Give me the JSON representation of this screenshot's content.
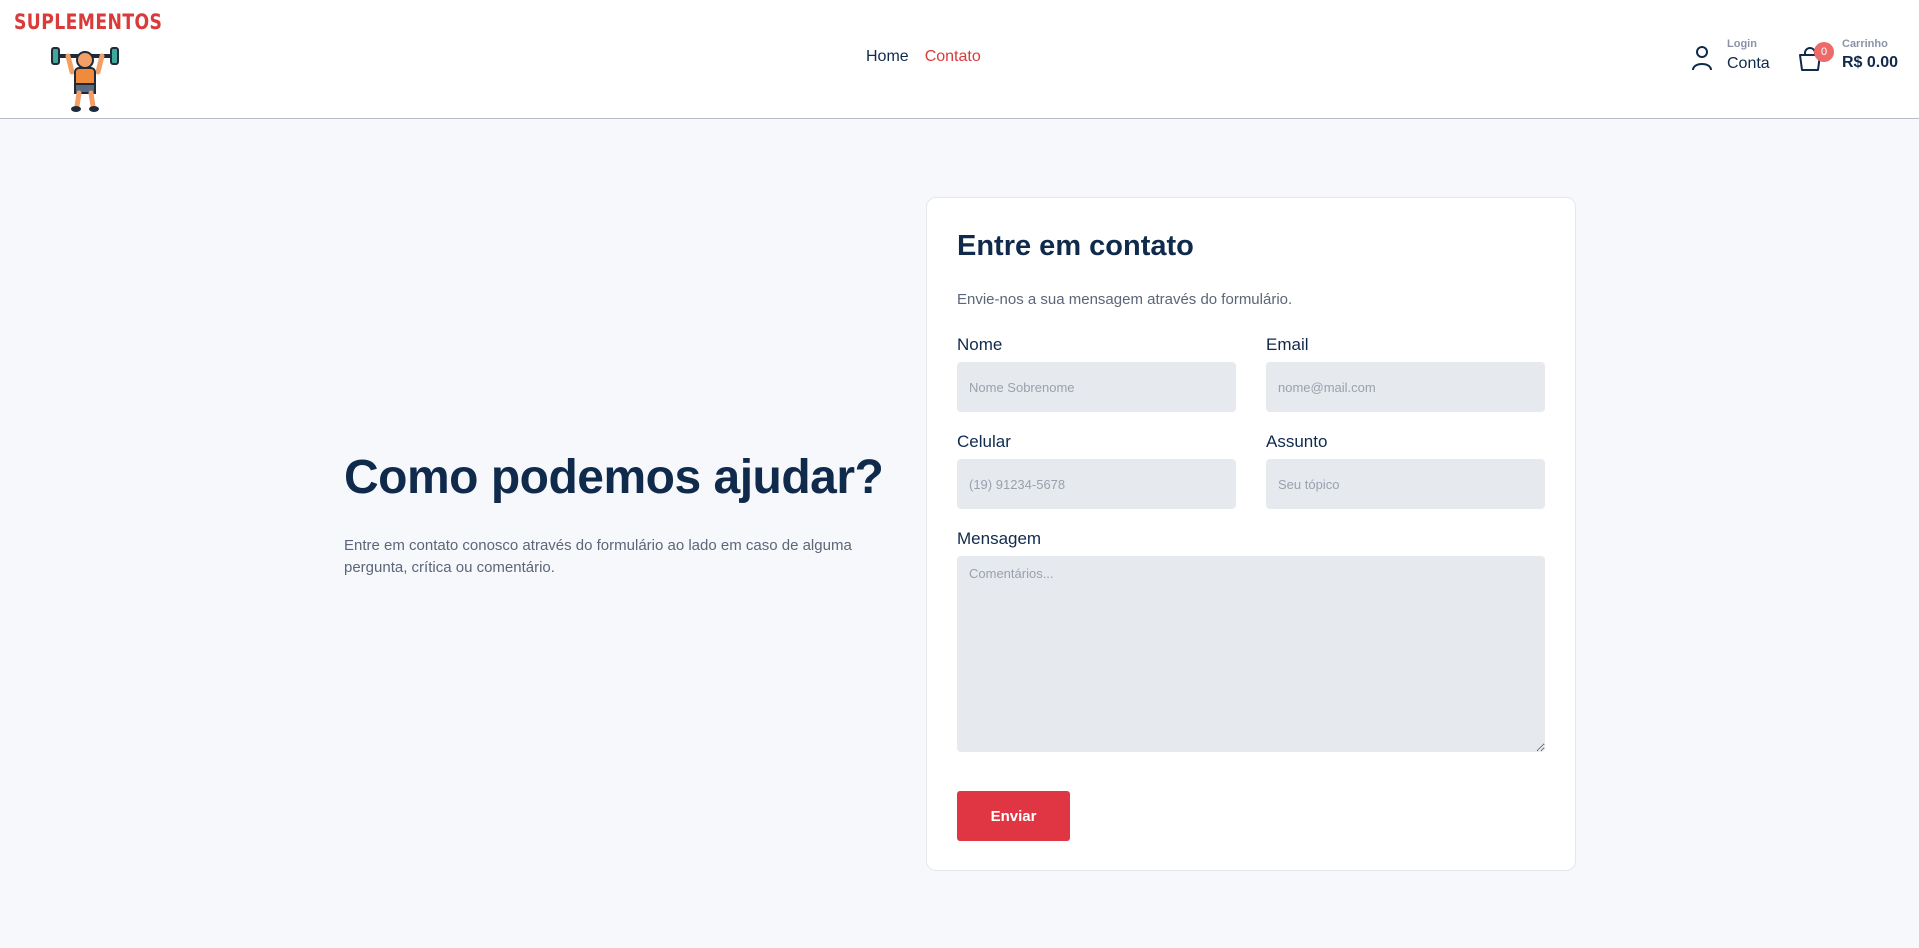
{
  "brand": {
    "name": "SUPLEMENTOS"
  },
  "nav": {
    "home": "Home",
    "contato": "Contato"
  },
  "account": {
    "small": "Login",
    "big": "Conta"
  },
  "cart": {
    "small": "Carrinho",
    "total": "R$ 0.00",
    "count": "0"
  },
  "intro": {
    "title": "Como podemos ajudar?",
    "text": "Entre em contato conosco através do formulário ao lado em caso de alguma pergunta, crítica ou comentário."
  },
  "form": {
    "title": "Entre em contato",
    "subtitle": "Envie-nos a sua mensagem através do formulário.",
    "nome": {
      "label": "Nome",
      "placeholder": "Nome Sobrenome"
    },
    "email": {
      "label": "Email",
      "placeholder": "nome@mail.com"
    },
    "celular": {
      "label": "Celular",
      "placeholder": "(19) 91234-5678"
    },
    "assunto": {
      "label": "Assunto",
      "placeholder": "Seu tópico"
    },
    "mensagem": {
      "label": "Mensagem",
      "placeholder": "Comentários..."
    },
    "submit": "Enviar"
  },
  "colors": {
    "accent": "#e03543",
    "navy": "#102a4c",
    "background": "#f7f8fc"
  }
}
